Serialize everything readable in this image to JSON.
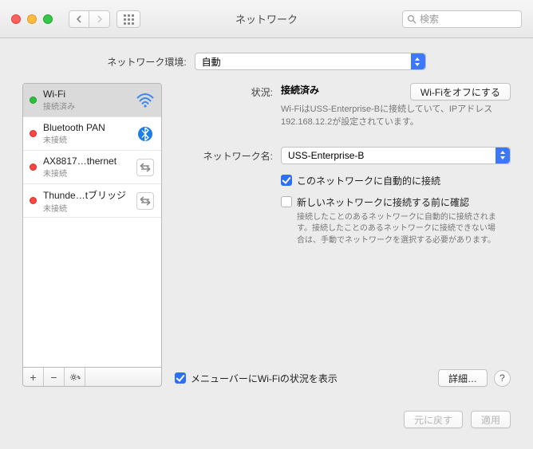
{
  "window": {
    "title": "ネットワーク"
  },
  "search": {
    "placeholder": "検索"
  },
  "location": {
    "label": "ネットワーク環境:",
    "value": "自動"
  },
  "services": [
    {
      "name": "Wi-Fi",
      "status": "接続済み",
      "dot": "g",
      "icon": "wifi"
    },
    {
      "name": "Bluetooth PAN",
      "status": "未接続",
      "dot": "r",
      "icon": "bt"
    },
    {
      "name": "AX8817…thernet",
      "status": "未接続",
      "dot": "r",
      "icon": "eth"
    },
    {
      "name": "Thunde…tブリッジ",
      "status": "未接続",
      "dot": "r",
      "icon": "eth"
    }
  ],
  "toolbar": {
    "add": "+",
    "remove": "−"
  },
  "detail": {
    "status_label": "状況:",
    "status_value": "接続済み",
    "turn_off": "Wi-Fiをオフにする",
    "status_desc": "Wi-FiはUSS-Enterprise-Bに接続していて、IPアドレス 192.168.12.2が設定されています。",
    "network_label": "ネットワーク名:",
    "network_value": "USS-Enterprise-B",
    "auto_join": "このネットワークに自動的に接続",
    "ask_new": "新しいネットワークに接続する前に確認",
    "ask_desc": "接続したことのあるネットワークに自動的に接続されます。接続したことのあるネットワークに接続できない場合は、手動でネットワークを選択する必要があります。",
    "show_menu": "メニューバーにWi-Fiの状況を表示",
    "advanced": "詳細…",
    "help": "?"
  },
  "buttons": {
    "revert": "元に戻す",
    "apply": "適用"
  }
}
